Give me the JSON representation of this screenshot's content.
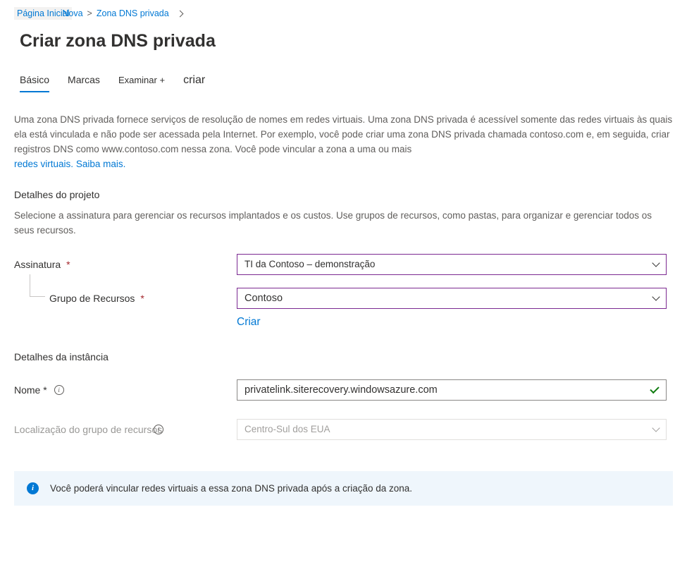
{
  "breadcrumb": {
    "home": "Página Inicial",
    "new": "Nova",
    "zone": "Zona DNS privada",
    "sep": ">"
  },
  "page_title": "Criar zona DNS privada",
  "tabs": {
    "basic": "Básico",
    "tags": "Marcas",
    "review": "Examinar +",
    "create": "criar"
  },
  "description": {
    "text": "Uma zona DNS privada fornece serviços de resolução de nomes em redes virtuais. Uma zona DNS privada é acessível somente das redes virtuais às quais ela está vinculada e não pode ser acessada pela Internet. Por exemplo, você pode criar uma zona DNS privada chamada contoso.com e, em seguida, criar registros DNS como www.contoso.com nessa zona. Você pode vincular a zona a uma ou mais",
    "link1": "redes virtuais.",
    "link2": "Saiba mais."
  },
  "project": {
    "heading": "Detalhes do projeto",
    "desc": "Selecione a assinatura para gerenciar os recursos implantados e os custos. Use grupos de recursos, como pastas, para organizar e gerenciar todos os seus recursos.",
    "subscription_label": "Assinatura",
    "subscription_value": "TI da Contoso – demonstração",
    "rg_label": "Grupo de Recursos",
    "rg_value": "Contoso",
    "create_new": "Criar",
    "required": "*"
  },
  "instance": {
    "heading": "Detalhes da instância",
    "name_label": "Nome *",
    "name_value": "privatelink.siterecovery.windowsazure.com",
    "location_label": "Localização do grupo de recursos",
    "location_value": "Centro-Sul dos EUA"
  },
  "banner": {
    "text": "Você poderá vincular redes virtuais a essa zona DNS privada após a criação da zona."
  }
}
